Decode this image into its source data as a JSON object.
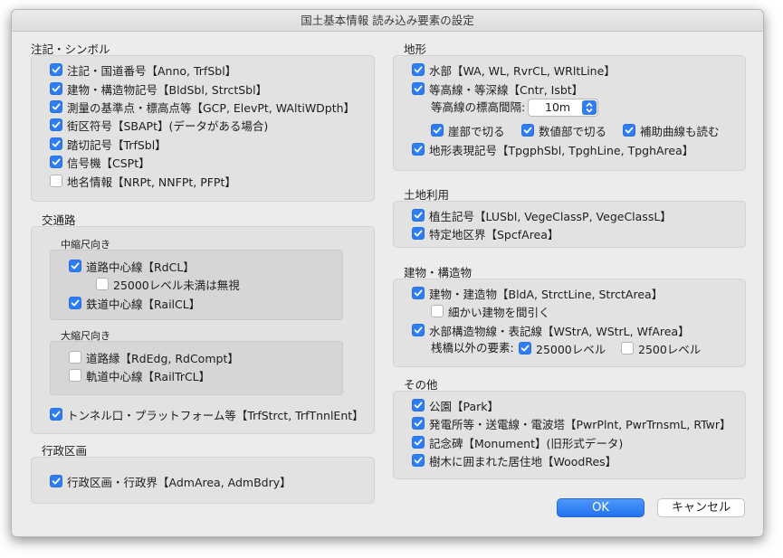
{
  "window": {
    "title": "国土基本情報 読み込み要素の設定"
  },
  "annotations": {
    "title": "注記・シンボル",
    "items": [
      {
        "label": "注記・国道番号【Anno, TrfSbl】",
        "checked": true
      },
      {
        "label": "建物・構造物記号【BldSbl, StrctSbl】",
        "checked": true
      },
      {
        "label": "測量の基準点・標高点等【GCP, ElevPt, WAltiWDpth】",
        "checked": true
      },
      {
        "label": "街区符号【SBAPt】(データがある場合)",
        "checked": true
      },
      {
        "label": "踏切記号【TrfSbl】",
        "checked": true
      },
      {
        "label": "信号機【CSPt】",
        "checked": true
      },
      {
        "label": "地名情報【NRPt, NNFPt, PFPt】",
        "checked": false
      }
    ]
  },
  "transport": {
    "title": "交通路",
    "medium": {
      "title": "中縮尺向き",
      "road_center": {
        "label": "道路中心線【RdCL】",
        "checked": true
      },
      "ignore_level": {
        "label": "25000レベル未満は無視",
        "checked": false
      },
      "rail_center": {
        "label": "鉄道中心線【RailCL】",
        "checked": true
      }
    },
    "large": {
      "title": "大縮尺向き",
      "road_edge": {
        "label": "道路縁【RdEdg, RdCompt】",
        "checked": false
      },
      "track_center": {
        "label": "軌道中心線【RailTrCL】",
        "checked": false
      }
    },
    "tunnel": {
      "label": "トンネル口・プラットフォーム等【TrfStrct, TrfTnnlEnt】",
      "checked": true
    }
  },
  "admin": {
    "title": "行政区画",
    "item": {
      "label": "行政区画・行政界【AdmArea, AdmBdry】",
      "checked": true
    }
  },
  "terrain": {
    "title": "地形",
    "water": {
      "label": "水部【WA, WL, RvrCL, WRltLine】",
      "checked": true
    },
    "contour": {
      "label": "等高線・等深線【Cntr, Isbt】",
      "checked": true
    },
    "interval_label": "等高線の標高間隔:",
    "interval_value": "10m",
    "cliff": {
      "label": "崖部で切る",
      "checked": true
    },
    "numeric": {
      "label": "数値部で切る",
      "checked": true
    },
    "aux": {
      "label": "補助曲線も読む",
      "checked": true
    },
    "symbol": {
      "label": "地形表現記号【TpgphSbl, TpghLine, TpghArea】",
      "checked": true
    }
  },
  "landuse": {
    "title": "土地利用",
    "vege": {
      "label": "植生記号【LUSbl, VegeClassP, VegeClassL】",
      "checked": true
    },
    "special": {
      "label": "特定地区界【SpcfArea】",
      "checked": true
    }
  },
  "buildings": {
    "title": "建物・構造物",
    "bld": {
      "label": "建物・建造物【BldA, StrctLine, StrctArea】",
      "checked": true
    },
    "thin": {
      "label": "細かい建物を間引く",
      "checked": false
    },
    "water_struct": {
      "label": "水部構造物線・表記線【WStrA, WStrL, WfArea】",
      "checked": true
    },
    "other_label": "桟橋以外の要素:",
    "lvl25000": {
      "label": "25000レベル",
      "checked": true
    },
    "lvl2500": {
      "label": "2500レベル",
      "checked": false
    }
  },
  "other": {
    "title": "その他",
    "items": [
      {
        "label": "公園【Park】",
        "checked": true
      },
      {
        "label": "発電所等・送電線・電波塔【PwrPlnt, PwrTrnsmL, RTwr】",
        "checked": true
      },
      {
        "label": "記念碑【Monument】(旧形式データ)",
        "checked": true
      },
      {
        "label": "樹木に囲まれた居住地【WoodRes】",
        "checked": true
      }
    ]
  },
  "buttons": {
    "ok": "OK",
    "cancel": "キャンセル"
  },
  "colors": {
    "accent": "#2f7df6",
    "panel": "#e2e2e2",
    "window": "#ececec"
  }
}
